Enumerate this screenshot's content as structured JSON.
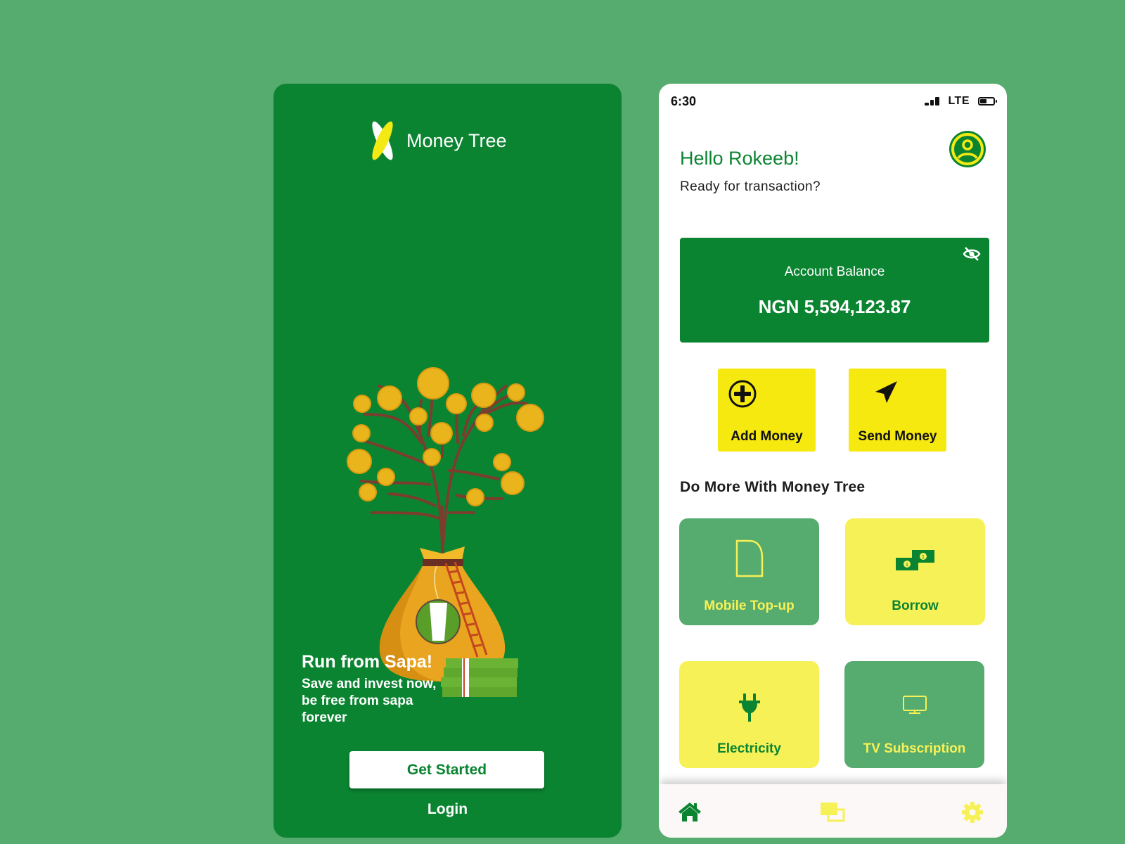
{
  "colors": {
    "page_bg": "#56ab6e",
    "primary_green": "#0b8431",
    "light_green": "#56ab6e",
    "bright_yellow": "#f5e90f",
    "soft_yellow": "#f7f158",
    "text_dark": "#1c1c1c",
    "white": "#ffffff"
  },
  "onboarding": {
    "brand_name": "Money Tree",
    "logo_icon": "money-tree-logo",
    "illustration": "money-tree-coin-bag-illustration",
    "hero_title": "Run from Sapa!",
    "hero_subtitle": "Save and invest now,\nbe free  from sapa\nforever",
    "get_started_label": "Get Started",
    "login_label": "Login"
  },
  "dashboard": {
    "status_bar": {
      "time": "6:30",
      "network": "LTE",
      "icons": [
        "signal-icon",
        "battery-icon"
      ]
    },
    "greeting": "Hello Rokeeb!",
    "subgreeting": "Ready for transaction?",
    "avatar_icon": "user-avatar-icon",
    "balance": {
      "label": "Account Balance",
      "value": "NGN 5,594,123.87",
      "toggle_icon": "eye-off-icon"
    },
    "actions": [
      {
        "label": "Add Money",
        "icon": "plus-circle-icon"
      },
      {
        "label": "Send Money",
        "icon": "paper-plane-icon"
      }
    ],
    "section_title": "Do More With Money Tree",
    "services": [
      {
        "label": "Mobile Top-up",
        "icon": "phone-card-icon"
      },
      {
        "label": "Borrow",
        "icon": "banknotes-icon"
      },
      {
        "label": "Electricity",
        "icon": "plug-icon"
      },
      {
        "label": "TV Subscription",
        "icon": "tv-icon"
      }
    ],
    "bottom_nav": [
      {
        "name": "home",
        "icon": "home-icon",
        "active": true
      },
      {
        "name": "cards",
        "icon": "cards-icon",
        "active": false
      },
      {
        "name": "settings",
        "icon": "gear-icon",
        "active": false
      }
    ]
  }
}
